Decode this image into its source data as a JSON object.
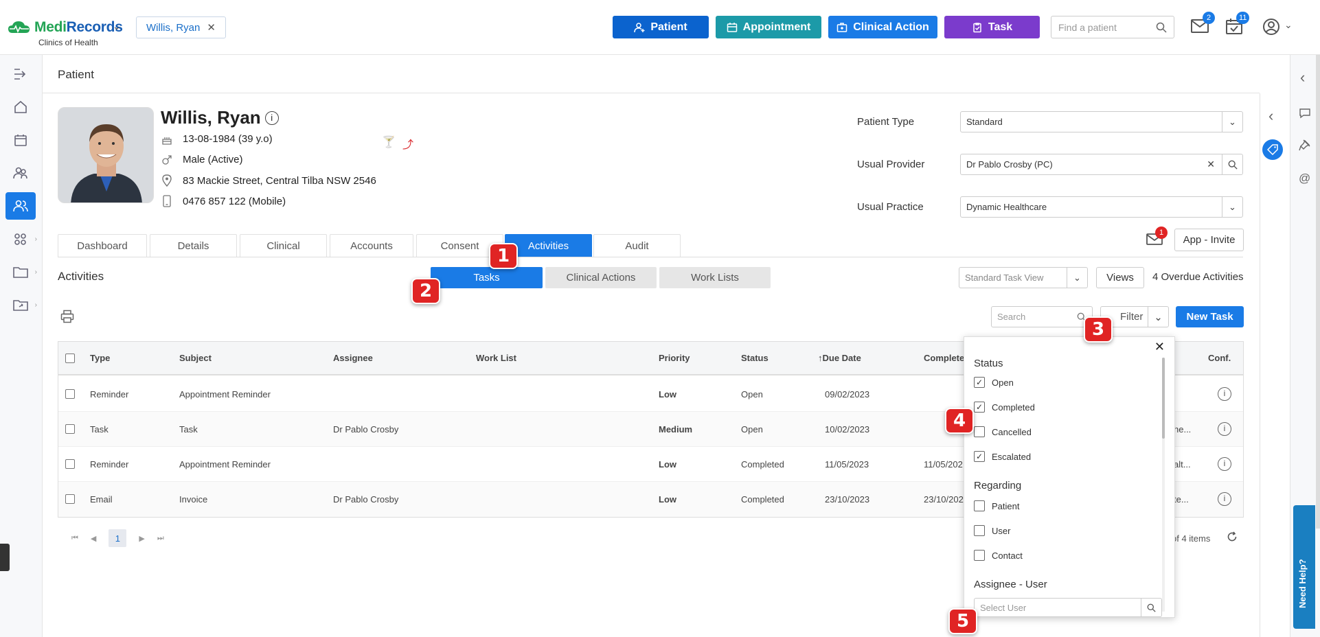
{
  "app": {
    "brand_part1": "Medi",
    "brand_part2": "Records",
    "subtitle": "Clinics of Health"
  },
  "header": {
    "patient_chip": "Willis, Ryan",
    "buttons": [
      {
        "label": "Patient",
        "color": "#0b63ce"
      },
      {
        "label": "Appointment",
        "color": "#1c9aa8"
      },
      {
        "label": "Clinical Action",
        "color": "#1a7be6"
      },
      {
        "label": "Task",
        "color": "#7b3bcc"
      }
    ],
    "find_placeholder": "Find a patient",
    "mail_count": "2",
    "tasks_count": "11"
  },
  "page": {
    "title": "Patient"
  },
  "patient": {
    "name": "Willis, Ryan",
    "dob": "13-08-1984 (39 y.o)",
    "gender": "Male (Active)",
    "address": "83 Mackie Street, Central Tilba NSW 2546",
    "phone": "0476 857 122 (Mobile)"
  },
  "fields": {
    "patient_type_label": "Patient Type",
    "patient_type_value": "Standard",
    "usual_provider_label": "Usual Provider",
    "usual_provider_value": "Dr Pablo Crosby (PC)",
    "usual_practice_label": "Usual Practice",
    "usual_practice_value": "Dynamic Healthcare"
  },
  "tabs": [
    "Dashboard",
    "Details",
    "Clinical",
    "Accounts",
    "Consent",
    "Activities",
    "Audit"
  ],
  "invite": {
    "badge": "1",
    "label": "App - Invite"
  },
  "activities": {
    "title": "Activities",
    "segments": [
      "Tasks",
      "Clinical Actions",
      "Work Lists"
    ],
    "view_placeholder": "Standard Task View",
    "views_label": "Views",
    "overdue": "4 Overdue Activities",
    "search_placeholder": "Search",
    "filter_label": "Filter",
    "new_task_label": "New Task"
  },
  "table": {
    "headers": [
      "Type",
      "Subject",
      "Assignee",
      "Work List",
      "Priority",
      "Status",
      "Due Date",
      "Complete",
      "Conf."
    ],
    "due_sort_arrow": "↑",
    "rows": [
      {
        "type": "Reminder",
        "subject": "Appointment Reminder",
        "assignee": "",
        "priority": "Low",
        "status": "Open",
        "due": "09/02/2023",
        "completed": "",
        "extra": ""
      },
      {
        "type": "Task",
        "subject": "Task",
        "assignee": "Dr Pablo Crosby",
        "priority": "Medium",
        "status": "Open",
        "due": "10/02/2023",
        "completed": "",
        "extra": "he..."
      },
      {
        "type": "Reminder",
        "subject": "Appointment Reminder",
        "assignee": "",
        "priority": "Low",
        "status": "Completed",
        "due": "11/05/2023",
        "completed": "11/05/202",
        "extra": "alt..."
      },
      {
        "type": "Email",
        "subject": "Invoice",
        "assignee": "Dr Pablo Crosby",
        "priority": "Low",
        "status": "Completed",
        "due": "23/10/2023",
        "completed": "23/10/202",
        "extra": "te..."
      }
    ]
  },
  "pager": {
    "page": "1",
    "items_text": "of 4 items"
  },
  "filter_popup": {
    "status_title": "Status",
    "status_options": [
      {
        "label": "Open",
        "checked": true
      },
      {
        "label": "Completed",
        "checked": true
      },
      {
        "label": "Cancelled",
        "checked": false
      },
      {
        "label": "Escalated",
        "checked": true
      }
    ],
    "regarding_title": "Regarding",
    "regarding_options": [
      {
        "label": "Patient",
        "checked": false
      },
      {
        "label": "User",
        "checked": false
      },
      {
        "label": "Contact",
        "checked": false
      }
    ],
    "assignee_title": "Assignee - User",
    "user_placeholder": "Select User"
  },
  "help": {
    "label": "Need Help?"
  },
  "markers": [
    "1",
    "2",
    "3",
    "4",
    "5"
  ]
}
